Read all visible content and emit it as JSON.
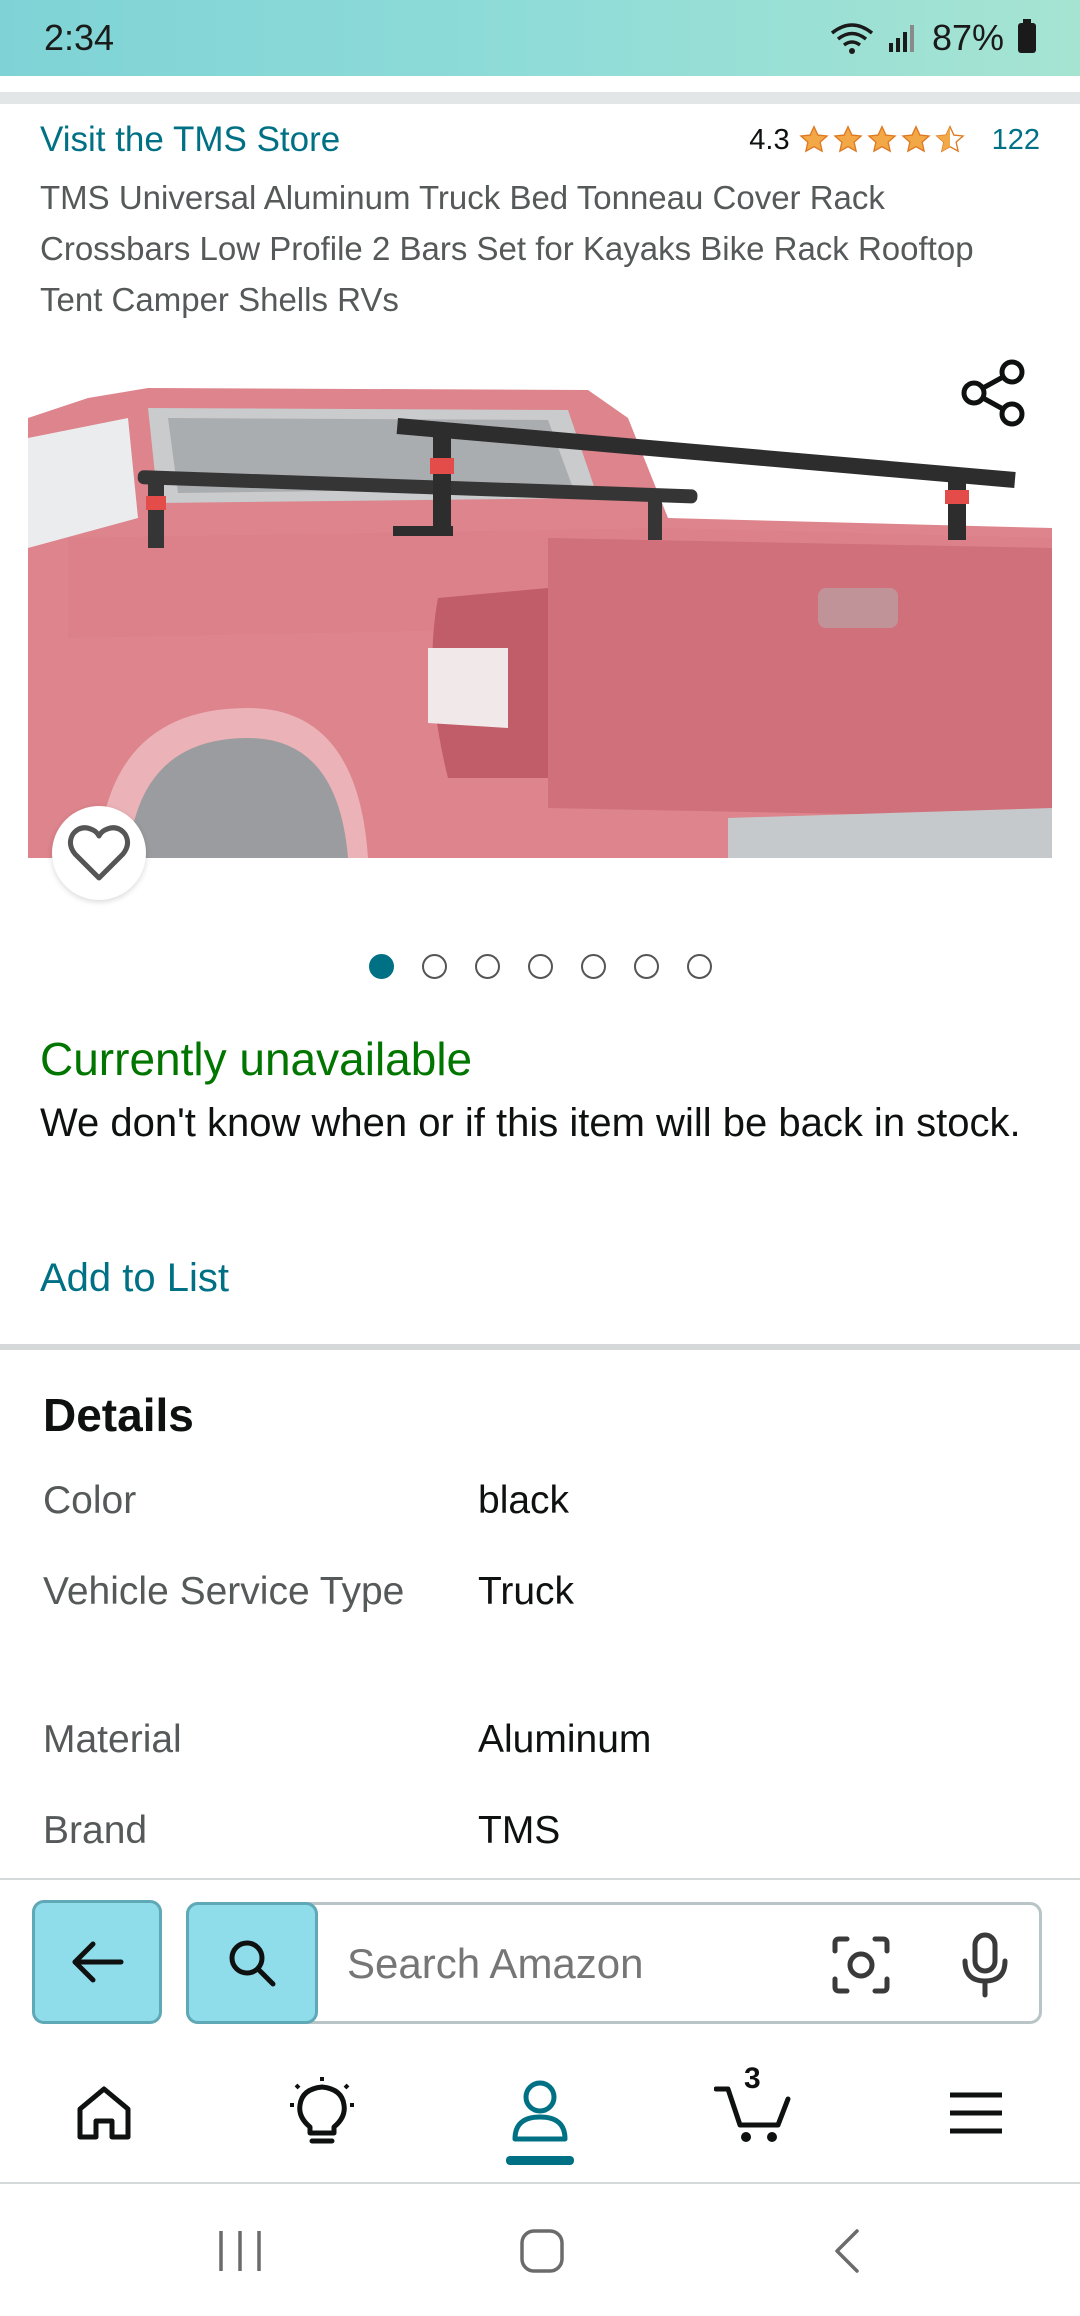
{
  "status_bar": {
    "time": "2:34",
    "battery": "87%"
  },
  "product": {
    "store_link": "Visit the TMS Store",
    "rating": "4.3",
    "review_count": "122",
    "title": "TMS Universal Aluminum Truck Bed Tonneau Cover Rack Crossbars Low Profile 2 Bars Set for Kayaks Bike Rack Rooftop Tent Camper Shells RVs",
    "image_count": 7,
    "active_image_index": 0
  },
  "availability": {
    "status": "Currently unavailable",
    "message": "We don't know when or if this item will be back in stock.",
    "add_to_list": "Add to List"
  },
  "details": {
    "title": "Details",
    "rows": [
      {
        "key": "Color",
        "value": "black"
      },
      {
        "key": "Vehicle Service Type",
        "value": "Truck"
      },
      {
        "key": "Material",
        "value": "Aluminum"
      },
      {
        "key": "Brand",
        "value": "TMS"
      }
    ]
  },
  "search": {
    "placeholder": "Search Amazon"
  },
  "nav": {
    "cart_count": "3"
  },
  "colors": {
    "accent": "#007185",
    "available_green": "#007600",
    "search_button": "#8fdcea",
    "star": "#f3a847"
  }
}
